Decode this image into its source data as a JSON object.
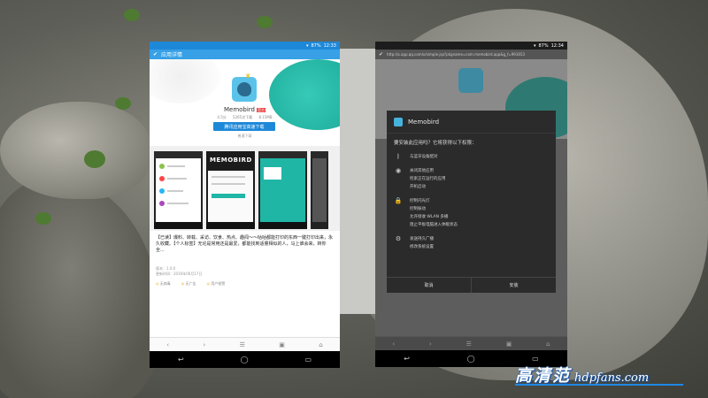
{
  "left_phone": {
    "status_time": "12:33",
    "status_battery": "87%",
    "title": "应用详情",
    "app_name": "Memobird",
    "app_badge": "官方",
    "app_meta": [
      "4.5分",
      "5265次下载",
      "8.15MB"
    ],
    "download_button": "腾讯应用宝高速下载",
    "download_note": "普通下载",
    "screenshot_logo": "MEMOBIRD",
    "description": "【已读】爆料、转载、采访、饮食、热点、趣闻～～咕咕都能打印的东西一键打印出来，永久收藏。【个人标签】无论是常用还是最爱，都能找到适量相似的人，马上谁会来，转你全...",
    "version": "版本：1.0.0",
    "update_date": "更新时间：2016年06月17日",
    "tags": [
      "无病毒",
      "无广告",
      "用户很赞"
    ],
    "nav_icons": [
      "back-icon",
      "forward-icon",
      "menu-icon",
      "tabs-icon",
      "home-icon"
    ]
  },
  "right_phone": {
    "status_time": "12:34",
    "status_battery": "87%",
    "url": "http://a.app.qq.com/o/simple.jsp?pkgname=com.memobird.app&g_f=991653",
    "dialog": {
      "app_name": "Memobird",
      "question": "要安装此应用吗？它将获得以下权限：",
      "groups": [
        {
          "icon": "bluetooth-icon",
          "glyph": "ᛒ",
          "items": [
            "与蓝牙设备配对"
          ]
        },
        {
          "icon": "eye-icon",
          "glyph": "◉",
          "items": [
            "关闭其他应用",
            "检索正在运行的应用",
            "开机启动"
          ]
        },
        {
          "icon": "lock-icon",
          "glyph": "🔒",
          "items": [
            "控制闪光灯",
            "控制振动",
            "允许接收 WLAN 多播",
            "阻止平板电脑进入休眠状态"
          ]
        },
        {
          "icon": "settings-icon",
          "glyph": "⚙",
          "items": [
            "发送持久广播",
            "修改系统设置"
          ]
        }
      ],
      "cancel": "取消",
      "install": "安装"
    }
  },
  "system_nav": [
    "back-icon",
    "home-icon",
    "recents-icon"
  ],
  "watermark": {
    "cn": "高清范",
    "en": "hdpfans.com"
  }
}
